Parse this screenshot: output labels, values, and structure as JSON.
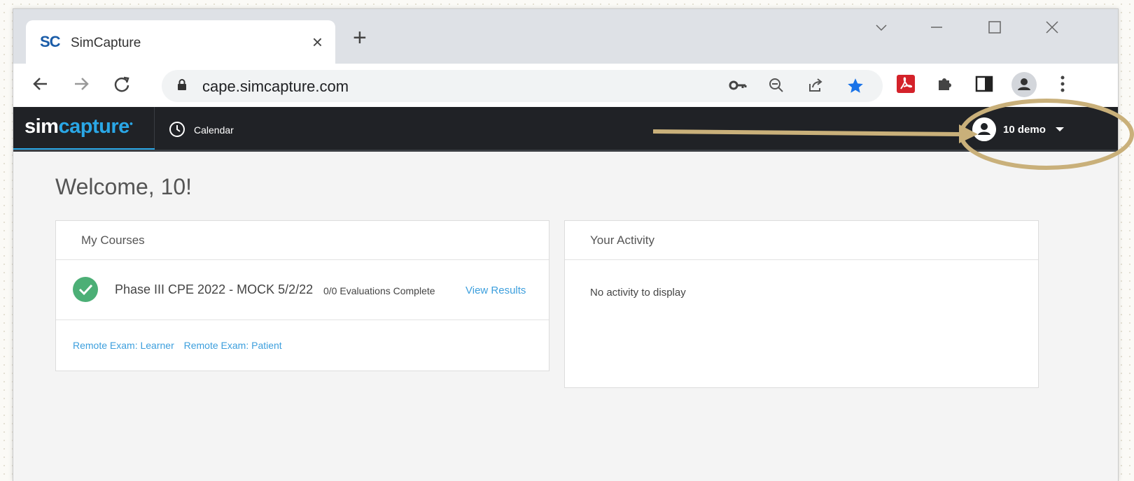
{
  "browser": {
    "tab_favicon": "SC",
    "tab_title": "SimCapture",
    "tab_close": "×",
    "new_tab": "+",
    "url": "cape.simcapture.com"
  },
  "app": {
    "logo_prefix": "sim",
    "logo_suffix": "capture",
    "nav_calendar": "Calendar",
    "user_name": "10 demo"
  },
  "main": {
    "welcome": "Welcome, 10!",
    "courses": {
      "title": "My Courses",
      "items": [
        {
          "name": "Phase III CPE 2022 - MOCK 5/2/22",
          "evaluations": "0/0 Evaluations Complete",
          "link": "View Results"
        }
      ],
      "links": [
        "Remote Exam: Learner",
        "Remote Exam: Patient"
      ]
    },
    "activity": {
      "title": "Your Activity",
      "empty": "No activity to display"
    }
  },
  "colors": {
    "brand_blue": "#2aa7e6",
    "nav_bg": "#202226",
    "check_green": "#4caf76",
    "annotation_gold": "#c9b07a"
  }
}
